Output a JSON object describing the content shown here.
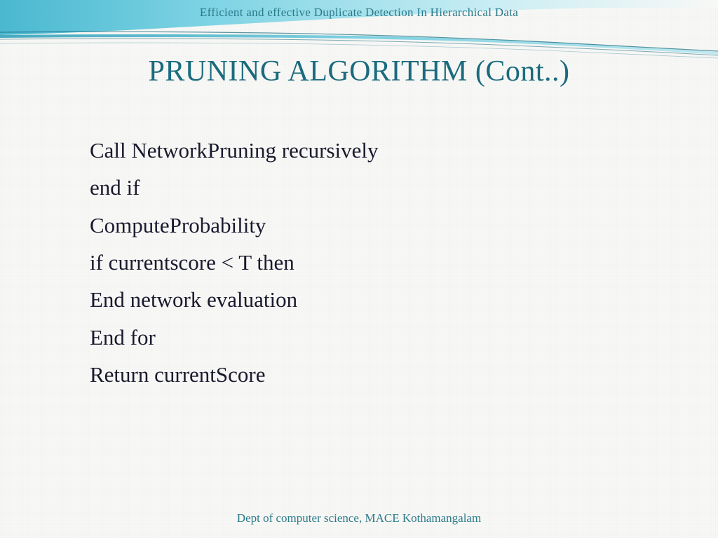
{
  "header": {
    "running_title": "Efficient and effective Duplicate Detection In Hierarchical Data"
  },
  "slide": {
    "title": "PRUNING ALGORITHM (Cont..)",
    "body_lines": [
      "Call NetworkPruning recursively",
      "end if",
      "ComputeProbability",
      "if currentscore < T then",
      "End network evaluation",
      "End for",
      "Return currentScore"
    ]
  },
  "footer": {
    "text": "Dept of computer science, MACE Kothamangalam"
  },
  "theme": {
    "accent": "#1a6b7d",
    "wave_light": "#cceef4",
    "wave_mid": "#67c9dd",
    "wave_dark": "#2a9db5"
  }
}
